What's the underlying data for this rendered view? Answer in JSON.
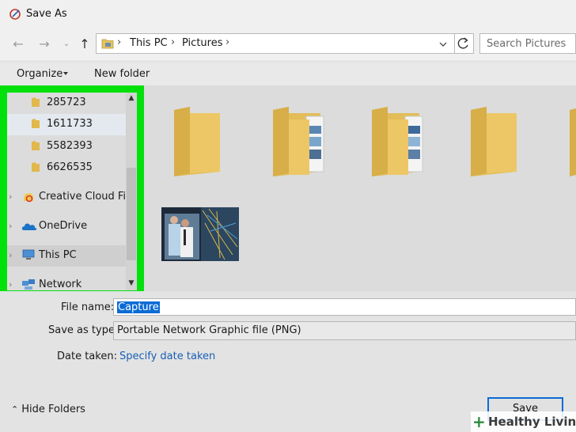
{
  "window": {
    "title": "Save As"
  },
  "address": {
    "crumbs": [
      "This PC",
      "Pictures"
    ],
    "search_placeholder": "Search Pictures"
  },
  "toolbar": {
    "organize_label": "Organize",
    "new_folder_label": "New folder"
  },
  "nav_pane": {
    "items": [
      {
        "label": "285723",
        "icon": "folder-icon"
      },
      {
        "label": "1611733",
        "icon": "folder-icon"
      },
      {
        "label": "5582393",
        "icon": "folder-icon"
      },
      {
        "label": "6626535",
        "icon": "folder-icon"
      },
      {
        "label": "Creative Cloud Files",
        "icon": "creative-cloud-icon"
      },
      {
        "label": "OneDrive",
        "icon": "onedrive-icon"
      },
      {
        "label": "This PC",
        "icon": "computer-icon"
      },
      {
        "label": "Network",
        "icon": "network-icon"
      }
    ],
    "highlight_color": "#00e10b"
  },
  "files": [
    {
      "type": "folder-icon"
    },
    {
      "type": "folder-with-files-icon"
    },
    {
      "type": "folder-with-files-icon"
    },
    {
      "type": "folder-icon"
    },
    {
      "type": "image-thumbnail"
    }
  ],
  "form": {
    "file_name_label": "File name:",
    "file_name_value": "Capture",
    "save_type_label": "Save as type:",
    "save_type_value": "Portable Network Graphic file (PNG)",
    "date_taken_label": "Date taken:",
    "date_taken_link": "Specify date taken"
  },
  "footer": {
    "hide_folders_label": "Hide Folders",
    "save_label": "Save"
  },
  "watermark": {
    "text": "Healthy Living"
  }
}
